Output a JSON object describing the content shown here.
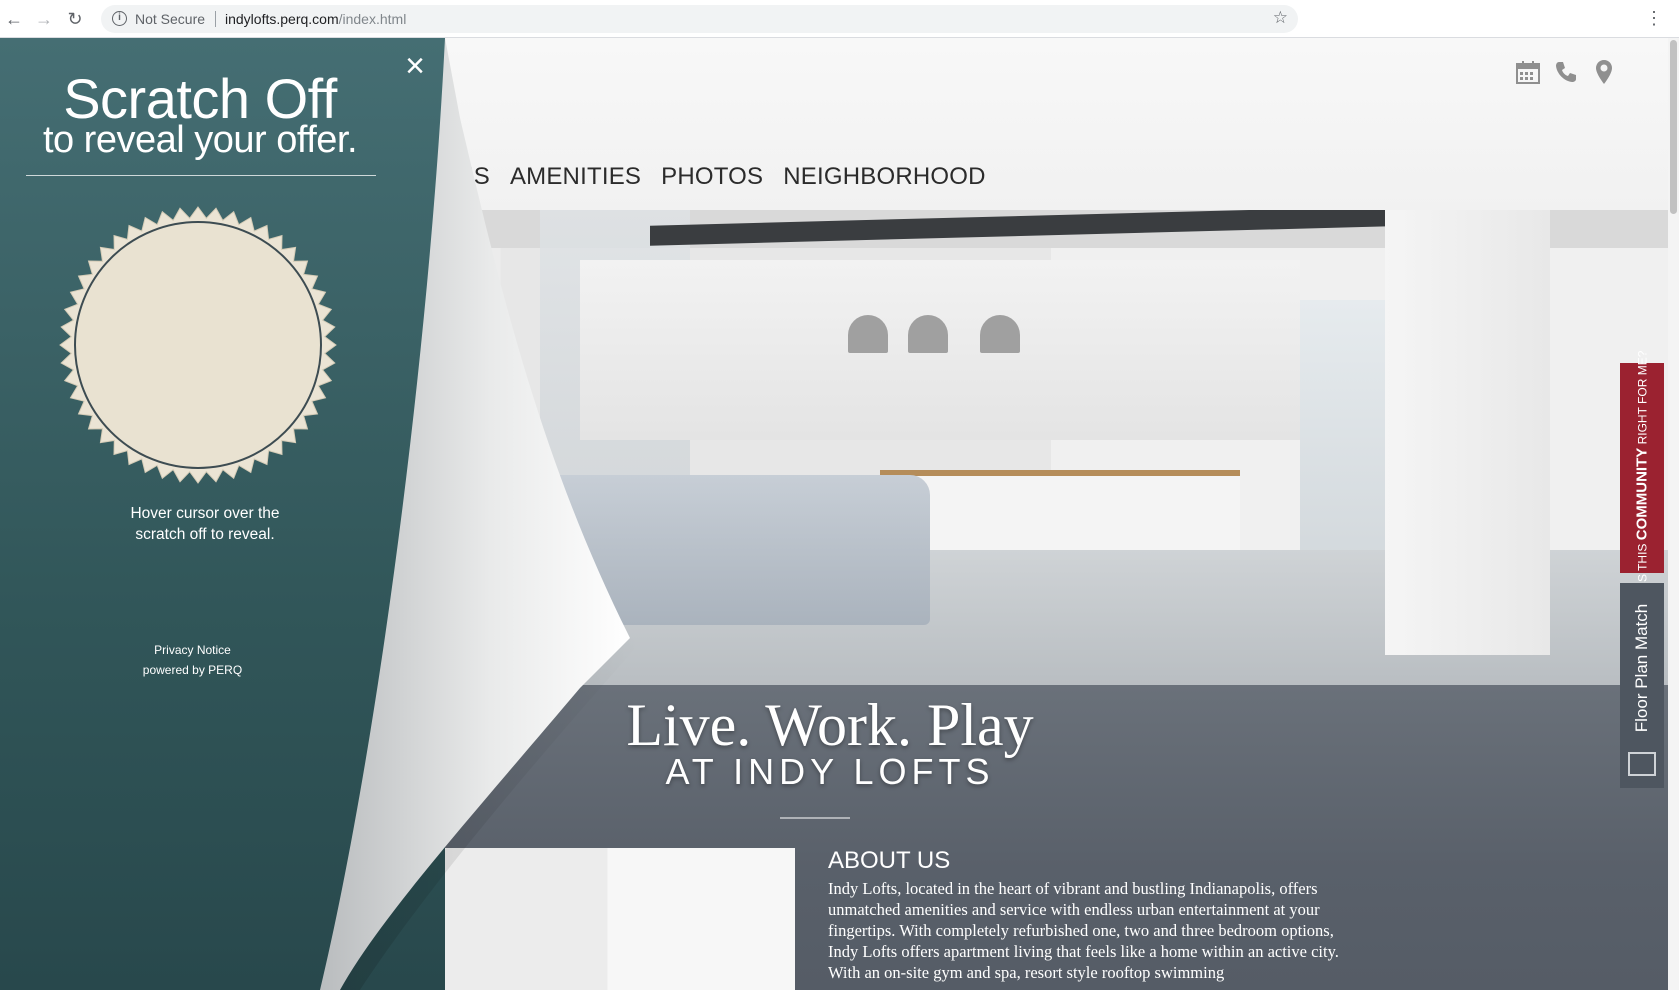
{
  "browser": {
    "security": "Not Secure",
    "url_host": "indylofts.perq.com",
    "url_path": "/index.html"
  },
  "header": {
    "nav": [
      "ANS",
      "AMENITIES",
      "PHOTOS",
      "NEIGHBORHOOD"
    ],
    "icons": [
      "calendar-icon",
      "phone-icon",
      "location-pin-icon"
    ]
  },
  "hero": {
    "tagline": "Live. Work. Play",
    "tagline_sub": "AT INDY LOFTS"
  },
  "about": {
    "title": "ABOUT US",
    "text": "Indy Lofts, located in the heart of vibrant and bustling Indianapolis, offers unmatched amenities and service with endless urban entertainment at your fingertips. With completely refurbished one, two and three bedroom options, Indy Lofts offers apartment living that feels like a home within an active city. With an on-site gym and spa, resort style rooftop swimming"
  },
  "side_tabs": {
    "community_pre": "IS THIS ",
    "community_bold": "COMMUNITY",
    "community_post": " RIGHT FOR ME?",
    "floor_plan": "Floor Plan Match"
  },
  "scratch": {
    "title": "Scratch Off",
    "subtitle": "to reveal your offer.",
    "hover_line1": "Hover cursor over the",
    "hover_line2": "scratch off to reveal.",
    "privacy": "Privacy Notice",
    "powered": "powered by PERQ",
    "close_glyph": "×"
  },
  "colors": {
    "overlay": "#315659",
    "accent_red": "#9b2230",
    "tab_gray": "#4e5660",
    "seal": "#ebe4d4"
  }
}
